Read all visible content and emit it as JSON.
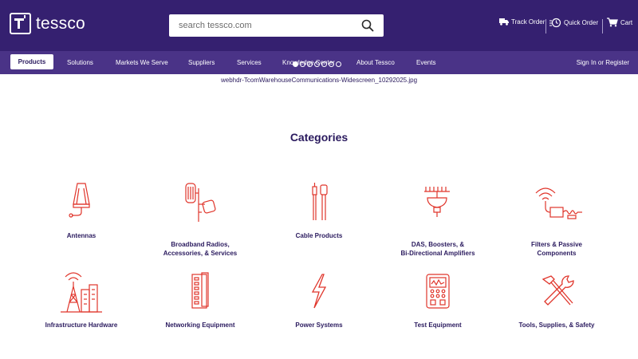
{
  "header": {
    "logo_text": "tessco",
    "search_placeholder": "search tessco.com",
    "track_order": "Track Order",
    "quick_order": "Quick Order",
    "cart": "Cart"
  },
  "nav": {
    "items": [
      {
        "label": "Products",
        "active": true
      },
      {
        "label": "Solutions"
      },
      {
        "label": "Markets We Serve"
      },
      {
        "label": "Suppliers"
      },
      {
        "label": "Services"
      },
      {
        "label": "Knowledge Center"
      },
      {
        "label": "About Tessco"
      },
      {
        "label": "Events"
      }
    ],
    "sign_in": "Sign In or Register"
  },
  "carousel": {
    "slides": 7,
    "active_index": 0,
    "image_alt": "webhdr-TcomWarehouseCommunications-Widescreen_10292025.jpg"
  },
  "categories": {
    "title": "Categories",
    "items": [
      {
        "label": "Antennas",
        "icon": "antenna-icon"
      },
      {
        "label": "Broadband Radios,\nAccessories, & Services",
        "icon": "radio-icon"
      },
      {
        "label": "Cable Products",
        "icon": "cable-icon"
      },
      {
        "label": "DAS, Boosters, &\nBi-Directional Amplifiers",
        "icon": "das-booster-icon"
      },
      {
        "label": "Filters & Passive\nComponents",
        "icon": "filter-icon"
      },
      {
        "label": "Infrastructure Hardware",
        "icon": "tower-icon"
      },
      {
        "label": "Networking Equipment",
        "icon": "network-switch-icon"
      },
      {
        "label": "Power Systems",
        "icon": "lightning-icon"
      },
      {
        "label": "Test Equipment",
        "icon": "meter-icon"
      },
      {
        "label": "Tools, Supplies, & Safety",
        "icon": "tools-icon"
      }
    ]
  },
  "colors": {
    "header_bg": "#352070",
    "nav_bg": "#4a3387",
    "text_primary": "#2a1a5e",
    "icon_accent": "#e0352b"
  }
}
